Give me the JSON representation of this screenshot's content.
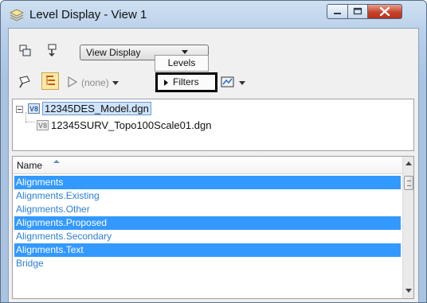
{
  "window": {
    "title": "Level Display - View 1",
    "icon": "levels-stack-icon"
  },
  "toolbar": {
    "display_mode": "View Display",
    "symbology_value": "(none)",
    "levels_label": "Levels",
    "filters_label": "Filters"
  },
  "tree": {
    "root": "12345DES_Model.dgn",
    "child": "12345SURV_Topo100Scale01.dgn"
  },
  "list": {
    "column_header": "Name",
    "rows": [
      {
        "name": "Alignments",
        "selected": true
      },
      {
        "name": "Alignments.Existing",
        "selected": false
      },
      {
        "name": "Alignments.Other",
        "selected": false
      },
      {
        "name": "Alignments.Proposed",
        "selected": true
      },
      {
        "name": "Alignments.Secondary",
        "selected": false
      },
      {
        "name": "Alignments.Text",
        "selected": true
      },
      {
        "name": "Bridge",
        "selected": false
      }
    ]
  },
  "colors": {
    "selection": "#3399ff",
    "level_text": "#2c80d0",
    "highlight_box": "#000000"
  }
}
